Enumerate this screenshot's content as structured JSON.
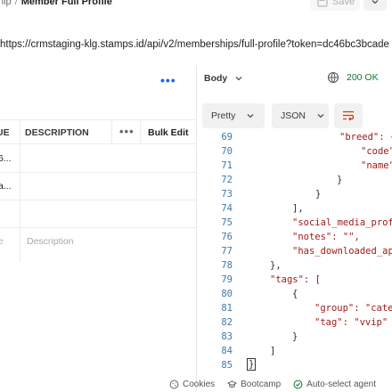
{
  "breadcrumb": {
    "parent": "nip",
    "separator": "/",
    "current": "Member Full Profile"
  },
  "toolbar": {
    "save_label": "Save"
  },
  "request": {
    "url": "https://crmstaging-klg.stamps.id/api/v2/memberships/full-profile?token=dc46bc3bcade"
  },
  "params_table": {
    "headers": {
      "value": "UE",
      "description": "DESCRIPTION",
      "bulk_edit": "Bulk Edit"
    },
    "rows": [
      {
        "value": "6...",
        "description": ""
      },
      {
        "value": "a...",
        "description": ""
      },
      {
        "value": "",
        "description": ""
      },
      {
        "value": "e",
        "description": "Description"
      }
    ]
  },
  "response": {
    "body_label": "Body",
    "status": "200 OK",
    "view_mode": "Pretty",
    "format": "JSON",
    "lines": [
      {
        "n": "69",
        "text": "\"breed\": {"
      },
      {
        "n": "70",
        "text": "\"code\""
      },
      {
        "n": "71",
        "text": "\"name\""
      },
      {
        "n": "72",
        "text": "}"
      },
      {
        "n": "73",
        "text": "}"
      },
      {
        "n": "74",
        "text": "],"
      },
      {
        "n": "75",
        "text": "\"social_media_prof"
      },
      {
        "n": "76",
        "text": "\"notes\": \"\","
      },
      {
        "n": "77",
        "text": "\"has_downloaded_ap"
      },
      {
        "n": "78",
        "text": "},"
      },
      {
        "n": "79",
        "text": "\"tags\": ["
      },
      {
        "n": "80",
        "text": "{"
      },
      {
        "n": "81",
        "text": "\"group\": \"cate"
      },
      {
        "n": "82",
        "text": "\"tag\": \"vvip\""
      },
      {
        "n": "83",
        "text": "}"
      },
      {
        "n": "84",
        "text": "]"
      },
      {
        "n": "85",
        "text": "}"
      }
    ]
  },
  "footer": {
    "cookies": "Cookies",
    "bootcamp": "Bootcamp",
    "agent": "Auto-select agent"
  },
  "colors": {
    "status_ok": "#0c7a2f",
    "link_blue": "#1a6fd6",
    "json_key": "#a11a1a",
    "line_number": "#3c7ab0"
  }
}
